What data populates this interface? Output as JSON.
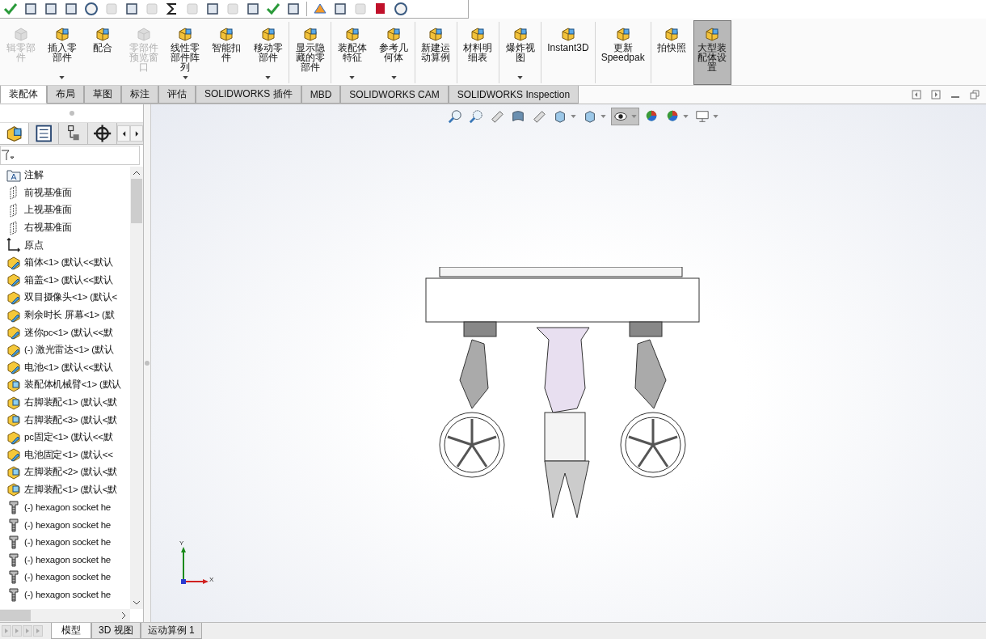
{
  "ribbon": [
    {
      "kind": "button",
      "label": "辑零部件",
      "disabled": true,
      "dropdown": false,
      "selected": false
    },
    {
      "kind": "button",
      "label": "插入零部件",
      "disabled": false,
      "dropdown": true,
      "selected": false
    },
    {
      "kind": "button",
      "label": "配合",
      "disabled": false,
      "dropdown": false,
      "selected": false
    },
    {
      "kind": "button",
      "label": "零部件预览窗口",
      "disabled": true,
      "dropdown": false,
      "selected": false
    },
    {
      "kind": "button",
      "label": "线性零部件阵列",
      "disabled": false,
      "dropdown": true,
      "selected": false
    },
    {
      "kind": "button",
      "label": "智能扣件",
      "disabled": false,
      "dropdown": false,
      "selected": false
    },
    {
      "kind": "button",
      "label": "移动零部件",
      "disabled": false,
      "dropdown": true,
      "selected": false
    },
    {
      "kind": "separator"
    },
    {
      "kind": "button",
      "label": "显示隐藏的零部件",
      "disabled": false,
      "dropdown": false,
      "selected": false
    },
    {
      "kind": "separator"
    },
    {
      "kind": "button",
      "label": "装配体特征",
      "disabled": false,
      "dropdown": true,
      "selected": false
    },
    {
      "kind": "button",
      "label": "参考几何体",
      "disabled": false,
      "dropdown": true,
      "selected": false
    },
    {
      "kind": "separator"
    },
    {
      "kind": "button",
      "label": "新建运动算例",
      "disabled": false,
      "dropdown": false,
      "selected": false
    },
    {
      "kind": "separator"
    },
    {
      "kind": "button",
      "label": "材料明细表",
      "disabled": false,
      "dropdown": false,
      "selected": false
    },
    {
      "kind": "separator"
    },
    {
      "kind": "button",
      "label": "爆炸视图",
      "disabled": false,
      "dropdown": true,
      "selected": false
    },
    {
      "kind": "separator"
    },
    {
      "kind": "button",
      "label": "Instant3D",
      "disabled": false,
      "dropdown": false,
      "selected": false
    },
    {
      "kind": "separator"
    },
    {
      "kind": "button",
      "label": "更新 Speedpak",
      "disabled": false,
      "dropdown": false,
      "selected": false
    },
    {
      "kind": "separator"
    },
    {
      "kind": "button",
      "label": "拍快照",
      "disabled": false,
      "dropdown": false,
      "selected": false
    },
    {
      "kind": "button",
      "label": "大型装配体设置",
      "disabled": false,
      "dropdown": false,
      "selected": true
    }
  ],
  "command_tabs": [
    {
      "label": "装配体",
      "selected": true
    },
    {
      "label": "布局",
      "selected": false
    },
    {
      "label": "草图",
      "selected": false
    },
    {
      "label": "标注",
      "selected": false
    },
    {
      "label": "评估",
      "selected": false
    },
    {
      "label": "SOLIDWORKS 插件",
      "selected": false
    },
    {
      "label": "MBD",
      "selected": false
    },
    {
      "label": "SOLIDWORKS CAM",
      "selected": false
    },
    {
      "label": "SOLIDWORKS Inspection",
      "selected": false
    }
  ],
  "feature_tree": {
    "items": [
      {
        "kind": "annotation",
        "label": "注解"
      },
      {
        "kind": "plane",
        "label": "前视基准面"
      },
      {
        "kind": "plane",
        "label": "上视基准面"
      },
      {
        "kind": "plane",
        "label": "右视基准面"
      },
      {
        "kind": "origin",
        "label": "原点"
      },
      {
        "kind": "part",
        "label": "箱体<1> (默认<<默认"
      },
      {
        "kind": "part",
        "label": "箱盖<1> (默认<<默认"
      },
      {
        "kind": "part",
        "label": "双目摄像头<1> (默认<"
      },
      {
        "kind": "part",
        "label": "剩余时长 屏幕<1> (默"
      },
      {
        "kind": "part",
        "label": "迷你pc<1> (默认<<默"
      },
      {
        "kind": "part",
        "label": "(-) 激光雷达<1> (默认"
      },
      {
        "kind": "part",
        "label": "电池<1> (默认<<默认"
      },
      {
        "kind": "assembly",
        "label": "装配体机械臂<1> (默认"
      },
      {
        "kind": "assembly",
        "label": "右脚装配<1> (默认<默"
      },
      {
        "kind": "assembly",
        "label": "右脚装配<3> (默认<默"
      },
      {
        "kind": "part",
        "label": "pc固定<1> (默认<<默"
      },
      {
        "kind": "part",
        "label": "电池固定<1> (默认<<"
      },
      {
        "kind": "assembly",
        "label": "左脚装配<2> (默认<默"
      },
      {
        "kind": "assembly",
        "label": "左脚装配<1> (默认<默"
      },
      {
        "kind": "bolt",
        "label": "(-) hexagon socket he"
      },
      {
        "kind": "bolt",
        "label": "(-) hexagon socket he"
      },
      {
        "kind": "bolt",
        "label": "(-) hexagon socket he"
      },
      {
        "kind": "bolt",
        "label": "(-) hexagon socket he"
      },
      {
        "kind": "bolt",
        "label": "(-) hexagon socket he"
      },
      {
        "kind": "bolt",
        "label": "(-) hexagon socket he"
      }
    ]
  },
  "view_toolbar": [
    {
      "kind": "zoom-fit",
      "dropdown": false,
      "selected": false
    },
    {
      "kind": "zoom-area",
      "dropdown": false,
      "selected": false
    },
    {
      "kind": "previous-view",
      "dropdown": false,
      "selected": false
    },
    {
      "kind": "section-view",
      "dropdown": false,
      "selected": false
    },
    {
      "kind": "dynamic-annotation",
      "dropdown": false,
      "selected": false
    },
    {
      "kind": "view-orientation",
      "dropdown": true,
      "selected": false
    },
    {
      "kind": "display-style",
      "dropdown": true,
      "selected": false
    },
    {
      "kind": "hide-show",
      "dropdown": true,
      "selected": true
    },
    {
      "kind": "edit-appearance",
      "dropdown": false,
      "selected": false
    },
    {
      "kind": "scene",
      "dropdown": true,
      "selected": false
    },
    {
      "kind": "view-settings",
      "dropdown": true,
      "selected": false
    }
  ],
  "triad": {
    "y_label": "Y",
    "x_label": "X"
  },
  "bottom_tabs": [
    {
      "label": "模型",
      "selected": true
    },
    {
      "label": "3D 视图",
      "selected": false
    },
    {
      "label": "运动算例 1",
      "selected": false
    }
  ]
}
